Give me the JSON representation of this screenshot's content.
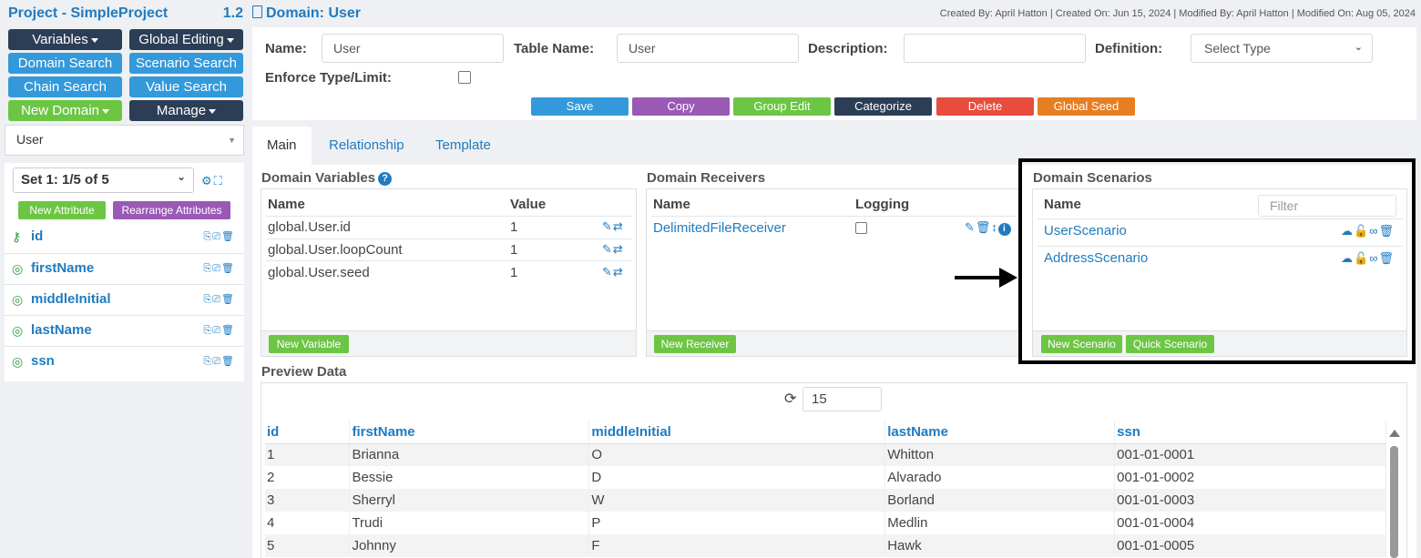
{
  "sidebar": {
    "project_title": "Project - SimpleProject",
    "version": "1.2",
    "buttons": {
      "variables": "Variables",
      "global_editing": "Global Editing",
      "domain_search": "Domain Search",
      "scenario_search": "Scenario Search",
      "chain_search": "Chain Search",
      "value_search": "Value Search",
      "new_domain": "New Domain",
      "manage": "Manage"
    },
    "domain_select": "User",
    "set_select": "Set 1: 1/5 of 5",
    "new_attribute": "New Attribute",
    "rearrange_attributes": "Rearrange Attributes",
    "attributes": [
      {
        "name": "id",
        "icon": "key-icon"
      },
      {
        "name": "firstName",
        "icon": "lifebuoy-icon"
      },
      {
        "name": "middleInitial",
        "icon": "lifebuoy-icon"
      },
      {
        "name": "lastName",
        "icon": "lifebuoy-icon"
      },
      {
        "name": "ssn",
        "icon": "lifebuoy-icon"
      }
    ]
  },
  "header": {
    "title": "Domain: User",
    "meta": "Created By: April Hatton | Created On: Jun 15, 2024 | Modified By: April Hatton | Modified On: Aug 05, 2024"
  },
  "form": {
    "name_label": "Name:",
    "name_value": "User",
    "table_name_label": "Table Name:",
    "table_name_value": "User",
    "description_label": "Description:",
    "description_value": "",
    "definition_label": "Definition:",
    "definition_value": "Select Type",
    "enforce_label": "Enforce Type/Limit:",
    "enforce_checked": false
  },
  "actions": {
    "save": "Save",
    "copy": "Copy",
    "group_edit": "Group Edit",
    "categorize": "Categorize",
    "delete": "Delete",
    "global_seed": "Global Seed"
  },
  "tabs": [
    "Main",
    "Relationship",
    "Template"
  ],
  "variables": {
    "title": "Domain Variables",
    "col_name": "Name",
    "col_value": "Value",
    "rows": [
      {
        "name": "global.User.id",
        "value": "1"
      },
      {
        "name": "global.User.loopCount",
        "value": "1"
      },
      {
        "name": "global.User.seed",
        "value": "1"
      }
    ],
    "new_button": "New Variable"
  },
  "receivers": {
    "title": "Domain Receivers",
    "col_name": "Name",
    "col_logging": "Logging",
    "rows": [
      {
        "name": "DelimitedFileReceiver",
        "logging": false
      }
    ],
    "new_button": "New Receiver"
  },
  "scenarios": {
    "title": "Domain Scenarios",
    "col_name": "Name",
    "filter_placeholder": "Filter",
    "rows": [
      {
        "name": "UserScenario"
      },
      {
        "name": "AddressScenario"
      }
    ],
    "new_button": "New Scenario",
    "quick_button": "Quick Scenario"
  },
  "preview": {
    "title": "Preview Data",
    "count": "15",
    "columns": [
      "id",
      "firstName",
      "middleInitial",
      "lastName",
      "ssn"
    ],
    "rows": [
      [
        "1",
        "Brianna",
        "O",
        "Whitton",
        "001-01-0001"
      ],
      [
        "2",
        "Bessie",
        "D",
        "Alvarado",
        "001-01-0002"
      ],
      [
        "3",
        "Sherryl",
        "W",
        "Borland",
        "001-01-0003"
      ],
      [
        "4",
        "Trudi",
        "P",
        "Medlin",
        "001-01-0004"
      ],
      [
        "5",
        "Johnny",
        "F",
        "Hawk",
        "001-01-0005"
      ]
    ]
  },
  "colors": {
    "accent_blue": "#1f7bc0",
    "button_blue": "#3399db",
    "button_green": "#6cc644",
    "button_purple": "#9b59b6",
    "button_dark": "#2c3e55",
    "button_red": "#e74c3c",
    "button_orange": "#e67e22"
  }
}
